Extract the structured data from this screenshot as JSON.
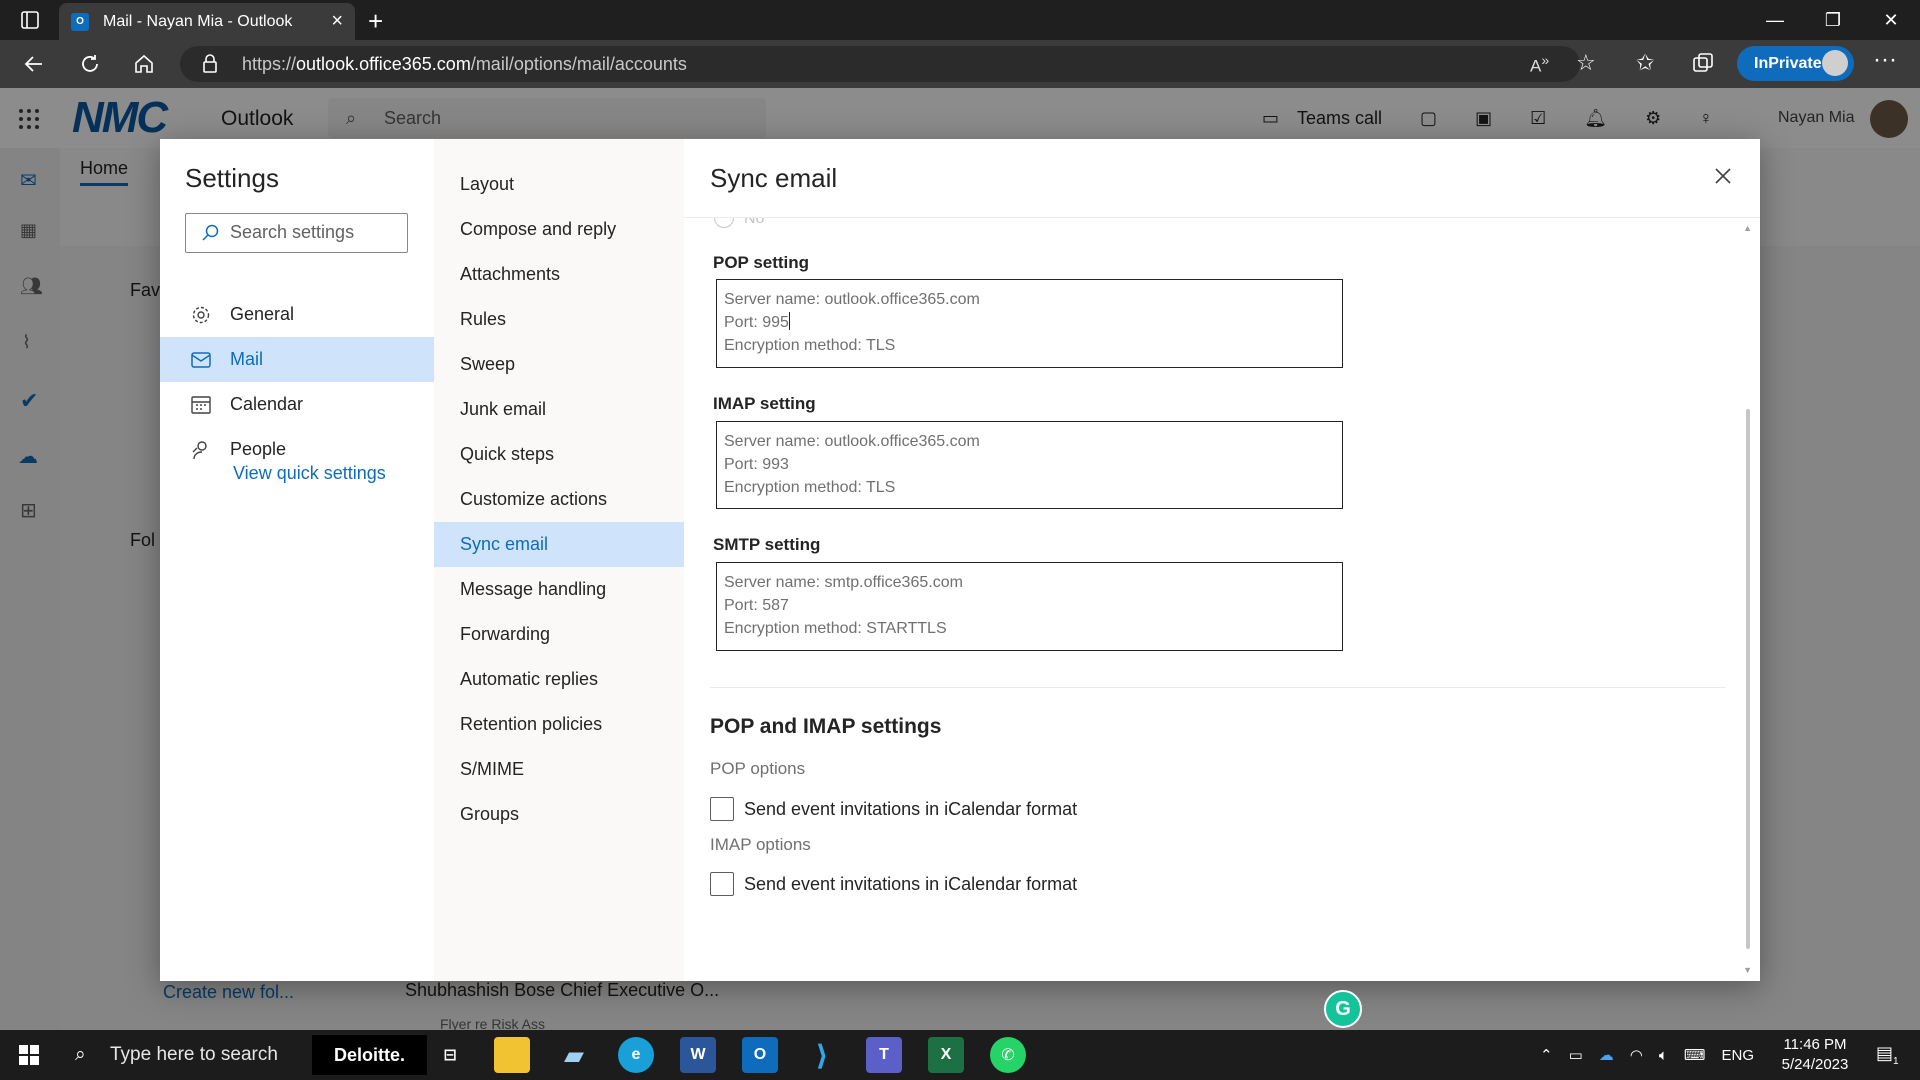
{
  "browser": {
    "tab_title": "Mail - Nayan Mia - Outlook",
    "url_prefix": "https://",
    "url_host": "outlook.office365.com",
    "url_path": "/mail/options/mail/accounts",
    "inprivate_label": "InPrivate"
  },
  "app": {
    "brand": "NMC",
    "title": "Outlook",
    "search_label": "Search",
    "teams_call": "Teams call",
    "user_name": "Nayan Mia",
    "home_tab": "Home",
    "bg_favorites": "Fav",
    "bg_folders": "Fol",
    "bg_create_folder": "Create new fol...",
    "bg_message_sender": "Shubhashish Bose Chief Executive O...",
    "bg_attachment": "Flyer re Risk Ass"
  },
  "settings": {
    "title": "Settings",
    "search_placeholder": "Search settings",
    "categories": [
      {
        "label": "General"
      },
      {
        "label": "Mail"
      },
      {
        "label": "Calendar"
      },
      {
        "label": "People"
      }
    ],
    "quick_settings": "View quick settings",
    "mail_sections": [
      {
        "label": "Layout"
      },
      {
        "label": "Compose and reply"
      },
      {
        "label": "Attachments"
      },
      {
        "label": "Rules"
      },
      {
        "label": "Sweep"
      },
      {
        "label": "Junk email"
      },
      {
        "label": "Quick steps"
      },
      {
        "label": "Customize actions"
      },
      {
        "label": "Sync email"
      },
      {
        "label": "Message handling"
      },
      {
        "label": "Forwarding"
      },
      {
        "label": "Automatic replies"
      },
      {
        "label": "Retention policies"
      },
      {
        "label": "S/MIME"
      },
      {
        "label": "Groups"
      }
    ]
  },
  "pane": {
    "title": "Sync email",
    "ghost_option": "No",
    "pop": {
      "label": "POP setting",
      "server": "Server name: outlook.office365.com",
      "port": "Port: 995",
      "encryption": "Encryption method: TLS"
    },
    "imap": {
      "label": "IMAP setting",
      "server": "Server name: outlook.office365.com",
      "port": "Port: 993",
      "encryption": "Encryption method: TLS"
    },
    "smtp": {
      "label": "SMTP setting",
      "server": "Server name: smtp.office365.com",
      "port": "Port: 587",
      "encryption": "Encryption method: STARTTLS"
    },
    "section_title": "POP and IMAP settings",
    "pop_options": "POP options",
    "pop_checkbox": "Send event invitations in iCalendar format",
    "imap_options": "IMAP options",
    "imap_checkbox": "Send event invitations in iCalendar format"
  },
  "taskbar": {
    "search_placeholder": "Type here to search",
    "deloitte": "Deloitte.",
    "language": "ENG",
    "time": "11:46 PM",
    "date": "5/24/2023",
    "notification_count": "1"
  },
  "colors": {
    "accent": "#0f6cbd",
    "selected_bg": "#cfe4fa"
  }
}
